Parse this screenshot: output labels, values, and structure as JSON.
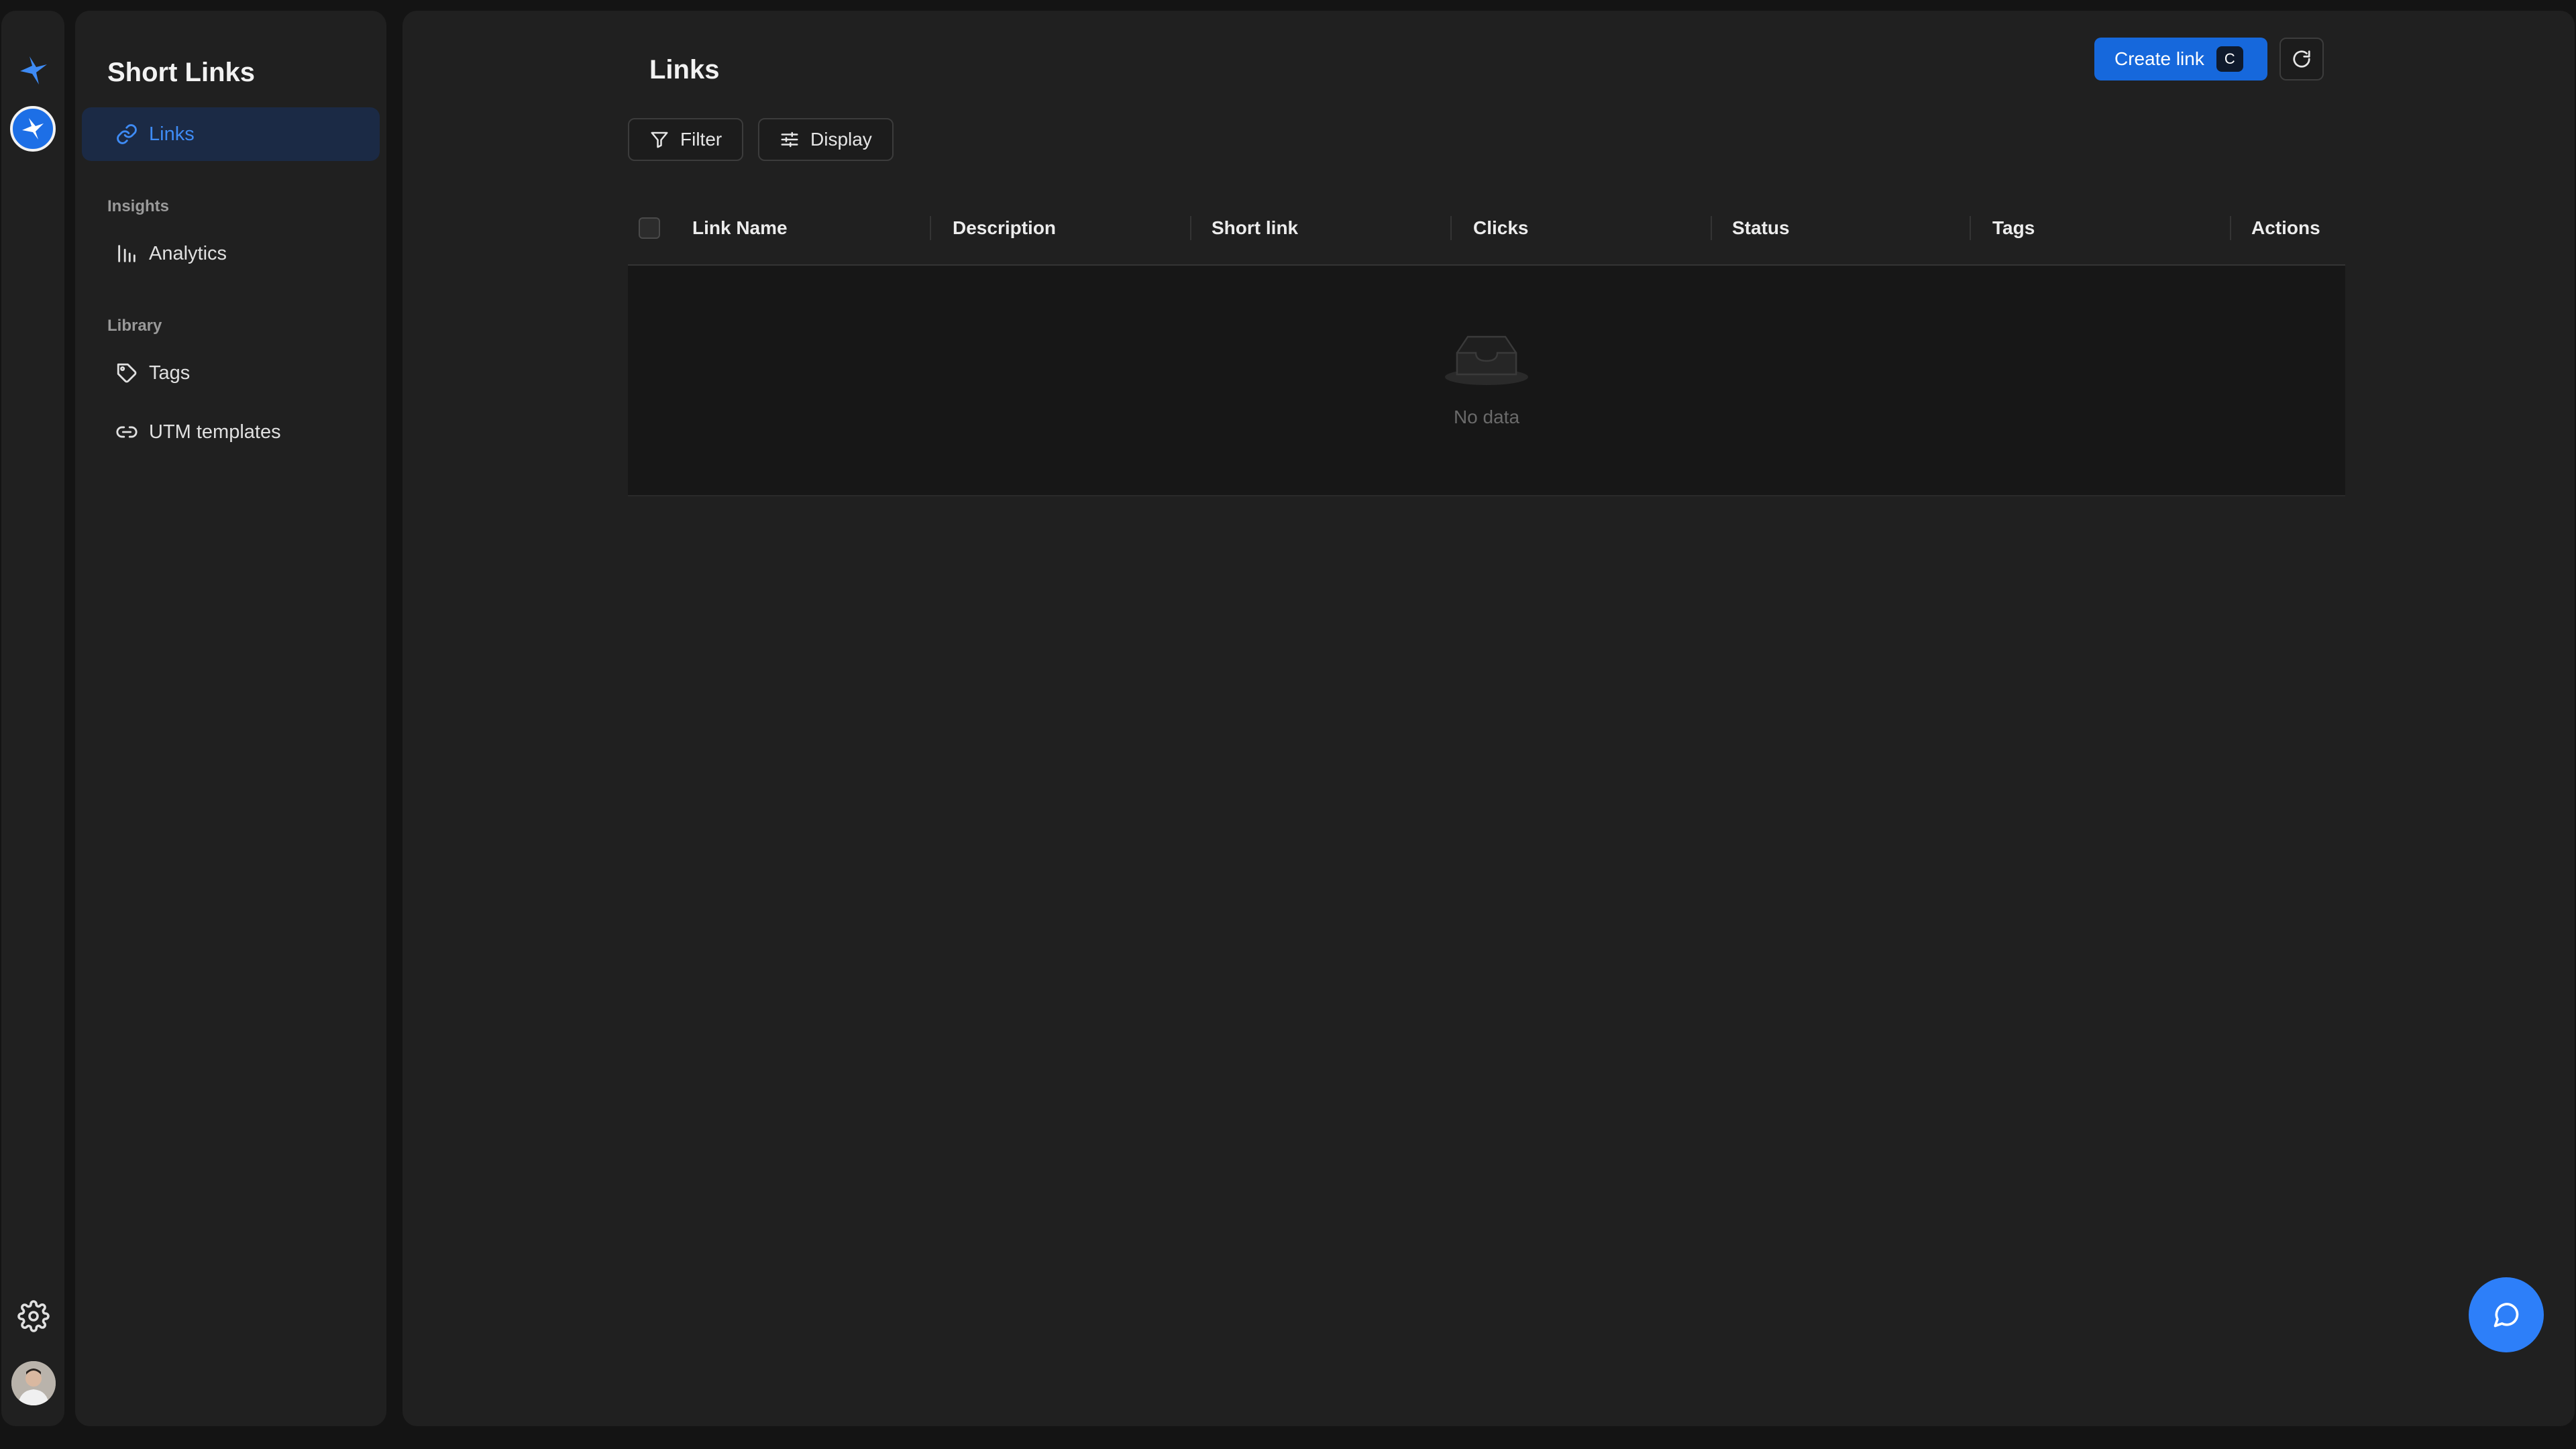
{
  "sidebar": {
    "title": "Short Links",
    "items": [
      {
        "label": "Links",
        "icon": "link-icon",
        "active": true
      }
    ],
    "insights_label": "Insights",
    "insights_items": [
      {
        "label": "Analytics",
        "icon": "bar-chart-icon"
      }
    ],
    "library_label": "Library",
    "library_items": [
      {
        "label": "Tags",
        "icon": "tag-icon"
      },
      {
        "label": "UTM templates",
        "icon": "link-icon"
      }
    ]
  },
  "header": {
    "title": "Links",
    "create_label": "Create link",
    "create_shortcut": "C"
  },
  "toolbar": {
    "filter_label": "Filter",
    "display_label": "Display"
  },
  "table": {
    "columns": [
      "Link Name",
      "Description",
      "Short link",
      "Clicks",
      "Status",
      "Tags",
      "Actions"
    ],
    "empty_text": "No data"
  },
  "colors": {
    "accent": "#1668dc",
    "active_nav_bg": "#1b2a45",
    "active_nav_text": "#3e8bf5",
    "panel_bg": "#202020",
    "chat_button": "#2d7ff9"
  }
}
